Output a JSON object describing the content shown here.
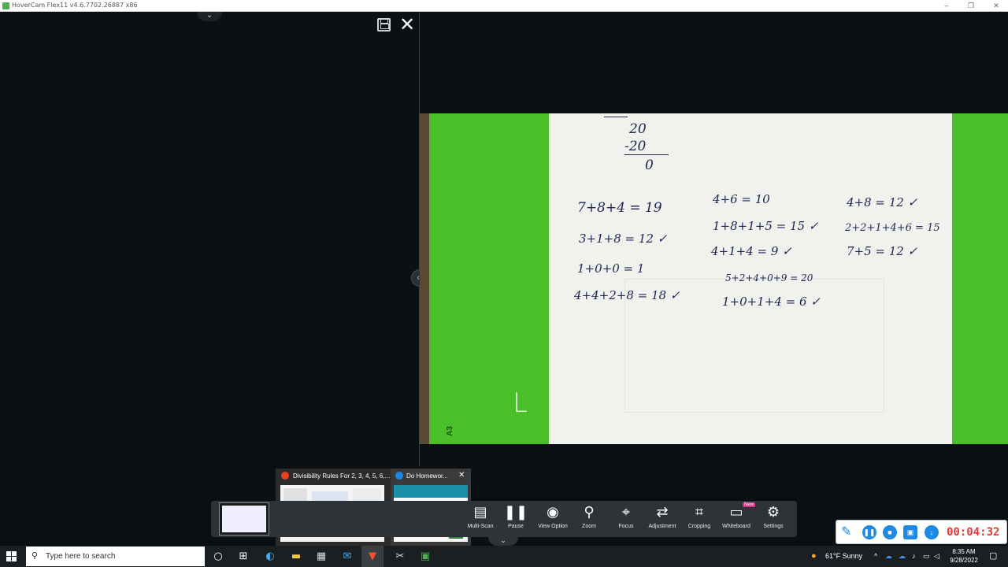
{
  "window": {
    "title": "HoverCam Flex11 v4.6.7702.26887 x86",
    "controls": [
      "–",
      "❐",
      "✕"
    ]
  },
  "left_panel": {
    "top_handle_glyph": "⌄",
    "close_glyph": "✕",
    "divider_glyph": "‹›"
  },
  "camera": {
    "marks": {
      "corner": "L",
      "side": "A3"
    },
    "handwriting": [
      {
        "text": "20"
      },
      {
        "text": "-20"
      },
      {
        "text": "0"
      },
      {
        "text": "7+8+4 = 19"
      },
      {
        "text": "3+1+8 = 12 ✓"
      },
      {
        "text": "1+0+0 = 1"
      },
      {
        "text": "4+4+2+8 = 18 ✓"
      },
      {
        "text": "4+6 = 10"
      },
      {
        "text": "1+8+1+5 = 15 ✓"
      },
      {
        "text": "4+1+4 = 9 ✓"
      },
      {
        "text": "5+2+4+0+9 = 20"
      },
      {
        "text": "1+0+1+4 = 6 ✓"
      },
      {
        "text": "4+8 = 12 ✓"
      },
      {
        "text": "2+2+1+4+6 = 15"
      },
      {
        "text": "7+5 = 12 ✓"
      }
    ]
  },
  "taskbar_previews": [
    {
      "title": "Divisibility Rules For 2, 3, 4, 5, 6,...",
      "icon_color": "#e8431e"
    },
    {
      "title": "Do Homewor...",
      "icon_color": "#1e88e5",
      "close": "✕"
    }
  ],
  "toolbar": {
    "items": [
      {
        "id": "multi-scan",
        "label": "Multi-Scan",
        "icon": "▤"
      },
      {
        "id": "pause",
        "label": "Pause",
        "icon": "❚❚"
      },
      {
        "id": "view-option",
        "label": "View Option",
        "icon": "◉"
      },
      {
        "id": "zoom",
        "label": "Zoom",
        "icon": "⚲"
      },
      {
        "id": "focus",
        "label": "Focus",
        "icon": "⌖"
      },
      {
        "id": "adjustment",
        "label": "Adjustment",
        "icon": "⇄"
      },
      {
        "id": "cropping",
        "label": "Cropping",
        "icon": "⌗"
      },
      {
        "id": "whiteboard",
        "label": "Whiteboard",
        "icon": "▭",
        "badge": "New"
      },
      {
        "id": "settings",
        "label": "Settings",
        "icon": "⚙"
      }
    ],
    "bottom_handle_glyph": "⌄"
  },
  "recorder": {
    "time": "00:04:32",
    "pencil": "✎",
    "pause": "❚❚",
    "stop": "■",
    "save": "▣",
    "download": "↓"
  },
  "windows_taskbar": {
    "search_placeholder": "Type here to search",
    "search_icon": "⚲",
    "cortana": "○",
    "task_view": "⊞",
    "weather": "61°F  Sunny",
    "tray_chevron": "^",
    "time": "8:35 AM",
    "date": "9/28/2022",
    "notification": "▢"
  },
  "colors": {
    "background": "#0a0f13",
    "green_screen": "#4bbf27",
    "paper": "#f1f1ee",
    "ink": "#1c2650",
    "toolbar": "#2e3338",
    "record_time": "#e53935",
    "record_buttons": "#1e88e5",
    "taskbar": "#1b1f22"
  }
}
